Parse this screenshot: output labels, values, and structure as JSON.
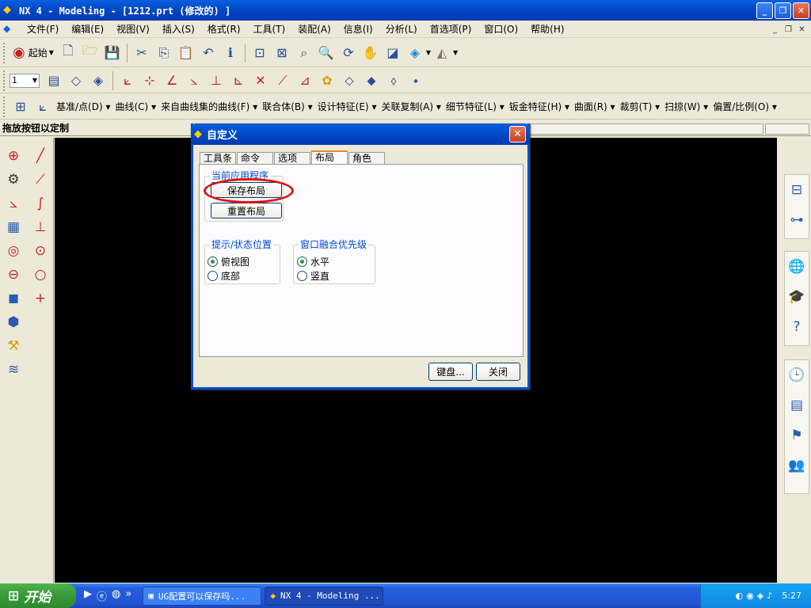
{
  "window": {
    "title": "NX 4 - Modeling - [1212.prt (修改的) ]",
    "buttons": {
      "min": "_",
      "max": "❐",
      "close": "✕"
    }
  },
  "menu": {
    "items": [
      "文件(F)",
      "编辑(E)",
      "视图(V)",
      "插入(S)",
      "格式(R)",
      "工具(T)",
      "装配(A)",
      "信息(I)",
      "分析(L)",
      "首选项(P)",
      "窗口(O)",
      "帮助(H)"
    ]
  },
  "toolbar1": {
    "start_label": "起始"
  },
  "toolbar2": {
    "layer_value": "1"
  },
  "toolbar3": {
    "items": [
      "基准/点(D)",
      "曲线(C)",
      "来自曲线集的曲线(F)",
      "联合体(B)",
      "设计特征(E)",
      "关联复制(A)",
      "细节特征(L)",
      "钣金特征(H)",
      "曲面(R)",
      "裁剪(T)",
      "扫掠(W)",
      "偏置/比例(O)"
    ]
  },
  "hint": "拖放按钮以定制",
  "dialog": {
    "title": "自定义",
    "tabs": [
      "工具条",
      "命令",
      "选项",
      "布局",
      "角色"
    ],
    "active_tab": "布局",
    "group_current": {
      "label": "当前应用程序",
      "save_button": "保存布局",
      "reset_button": "重置布局"
    },
    "group_prompt": {
      "label": "提示/状态位置",
      "options": [
        "俯视图",
        "底部"
      ],
      "selected": "俯视图"
    },
    "group_window": {
      "label": "窗口融合优先级",
      "options": [
        "水平",
        "竖直"
      ],
      "selected": "水平"
    },
    "keyboard_button": "键盘...",
    "close_button": "关闭"
  },
  "taskbar": {
    "start": "开始",
    "tasks": [
      {
        "label": "UG配置可以保存吗...",
        "active": false
      },
      {
        "label": "NX 4 - Modeling ...",
        "active": true
      }
    ],
    "clock": "5:27"
  },
  "colors": {
    "title_blue": "#0049c6",
    "highlight_red": "#e01010",
    "taskbar_blue": "#245edb",
    "start_green": "#3a9c3a"
  }
}
